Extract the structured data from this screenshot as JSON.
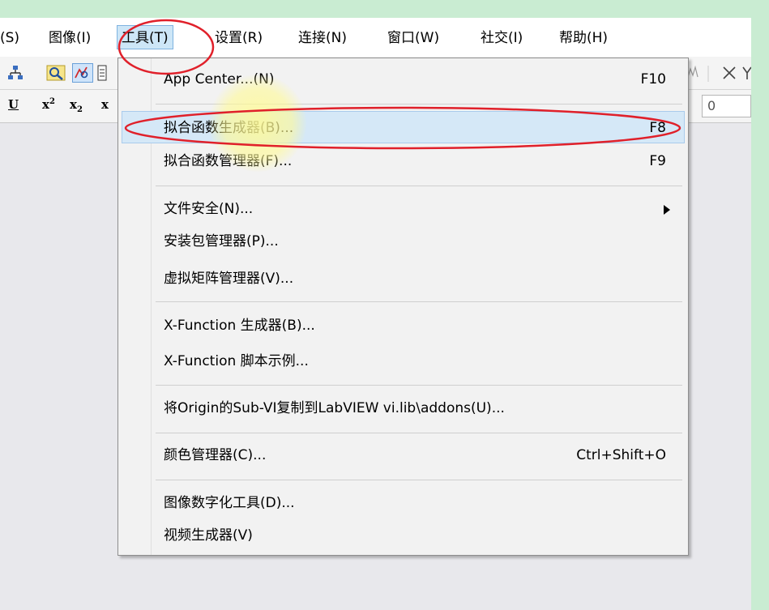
{
  "menubar": {
    "items": [
      {
        "label": "(S)",
        "active": false
      },
      {
        "label": "图像(I)",
        "active": false
      },
      {
        "label": "工具(T)",
        "active": true
      },
      {
        "label": "设置(R)",
        "active": false
      },
      {
        "label": "连接(N)",
        "active": false
      },
      {
        "label": "窗口(W)",
        "active": false
      },
      {
        "label": "社交(I)",
        "active": false
      },
      {
        "label": "帮助(H)",
        "active": false
      }
    ]
  },
  "toolbar": {
    "format": {
      "underline": "U",
      "superscript": "x",
      "sup2": "2",
      "subscript": "x",
      "sub2": "2",
      "supsub": "x"
    },
    "number_field_value": "0"
  },
  "dropdown": {
    "items": [
      {
        "label": "App Center...(N)",
        "accel": "F10"
      },
      {
        "label": "拟合函数生成器(B)...",
        "accel": "F8"
      },
      {
        "label": "拟合函数管理器(F)...",
        "accel": "F9"
      },
      {
        "label": "文件安全(N)...",
        "accel": ""
      },
      {
        "label": "安装包管理器(P)...",
        "accel": ""
      },
      {
        "label": "虚拟矩阵管理器(V)...",
        "accel": ""
      },
      {
        "label": "X-Function 生成器(B)...",
        "accel": ""
      },
      {
        "label": "X-Function 脚本示例...",
        "accel": ""
      },
      {
        "label": "将Origin的Sub-VI复制到LabVIEW vi.lib\\addons(U)...",
        "accel": ""
      },
      {
        "label": "颜色管理器(C)...",
        "accel": "Ctrl+Shift+O"
      },
      {
        "label": "图像数字化工具(D)...",
        "accel": ""
      },
      {
        "label": "视频生成器(V)",
        "accel": ""
      }
    ]
  },
  "colors": {
    "accent_highlight": "#d5e8f7",
    "annotation_red": "#e0202a",
    "background_green": "#c9ecd2"
  }
}
